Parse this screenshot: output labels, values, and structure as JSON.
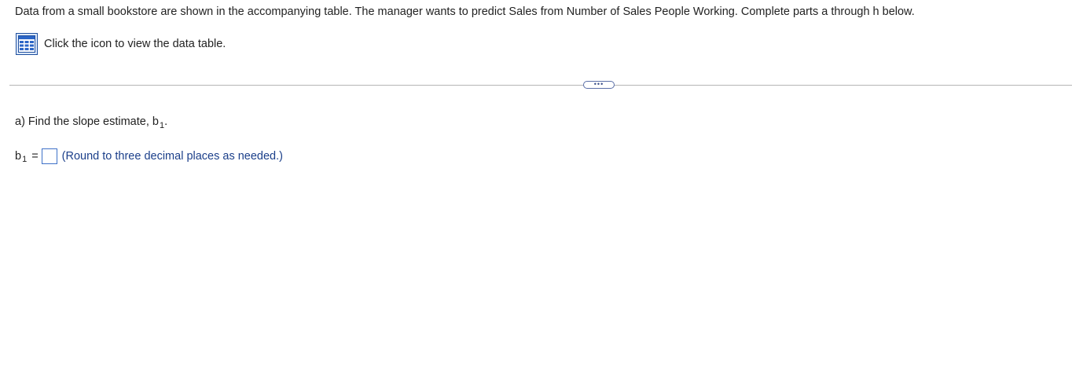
{
  "problem": {
    "intro": "Data from a small bookstore are shown in the accompanying table. The manager wants to predict Sales from Number of Sales People Working. Complete parts a through h below.",
    "data_link_text": "Click the icon to view the data table.",
    "data_icon": "table-grid-icon",
    "more_button_label": "•••"
  },
  "part_a": {
    "question_text": "a) Find the slope estimate, b",
    "question_sub": "1",
    "question_end": ".",
    "answer_label": "b",
    "answer_label_sub": "1",
    "answer_equals": "=",
    "answer_value": "",
    "hint": "(Round to three decimal places as needed.)"
  },
  "colors": {
    "hint": "#1b3f8a",
    "input_border": "#3e71c8",
    "icon_border": "#1f4f9e"
  }
}
